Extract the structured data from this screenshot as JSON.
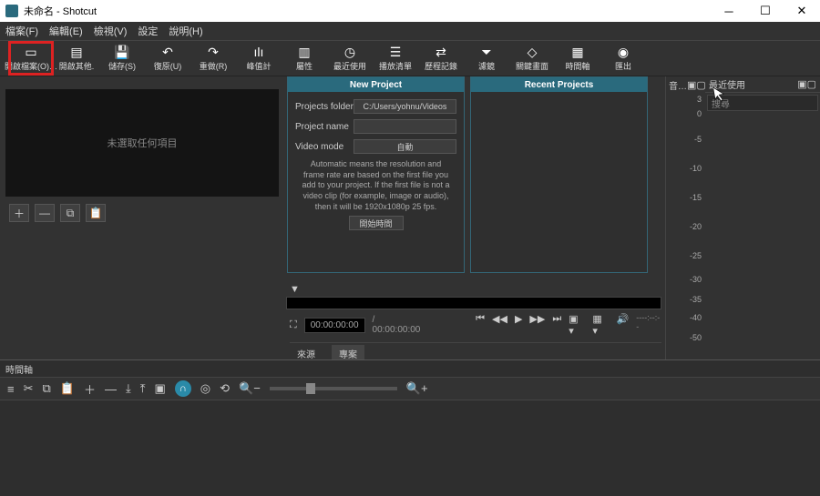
{
  "window": {
    "title": "未命名 - Shotcut"
  },
  "menu": {
    "file": "檔案(F)",
    "edit": "編輯(E)",
    "view": "檢視(V)",
    "settings": "設定",
    "help": "說明(H)"
  },
  "toolbar": {
    "openFile": "開啟檔案(O)…",
    "openOther": "開啟其他.",
    "save": "儲存(S)",
    "undo": "復原(U)",
    "redo": "重做(R)",
    "peakMeter": "峰值計",
    "properties": "屬性",
    "recent": "最近使用",
    "playlist": "播放清單",
    "history": "歷程記錄",
    "filters": "濾鏡",
    "keyframes": "關鍵畫面",
    "timeline": "時間軸",
    "export": "匯出"
  },
  "leftPreview": {
    "empty": "未選取任何項目"
  },
  "project": {
    "newTitle": "New Project",
    "recentTitle": "Recent Projects",
    "folderLabel": "Projects folder",
    "folderValue": "C:/Users/yohnu/Videos",
    "nameLabel": "Project name",
    "nameValue": "",
    "videoModeLabel": "Video mode",
    "videoModeValue": "自動",
    "help": "Automatic means the resolution and frame rate are based on the first file you add to your project. If the first file is not a video clip (for example, image or audio), then it will be 1920x1080p 25 fps.",
    "startBtn": "開始時間"
  },
  "transport": {
    "tcIn": "00:00:00:00",
    "tcDur": "/ 00:00:00:00",
    "tabSource": "來源",
    "tabProject": "專案"
  },
  "right": {
    "audioHdr": "音…",
    "recentHdr": "最近使用",
    "searchPlaceholder": "搜尋",
    "scale": [
      "3",
      "0",
      "-5",
      "-10",
      "-15",
      "-20",
      "-25",
      "-30",
      "-35",
      "-40",
      "-50"
    ]
  },
  "timeline": {
    "title": "時間軸"
  }
}
